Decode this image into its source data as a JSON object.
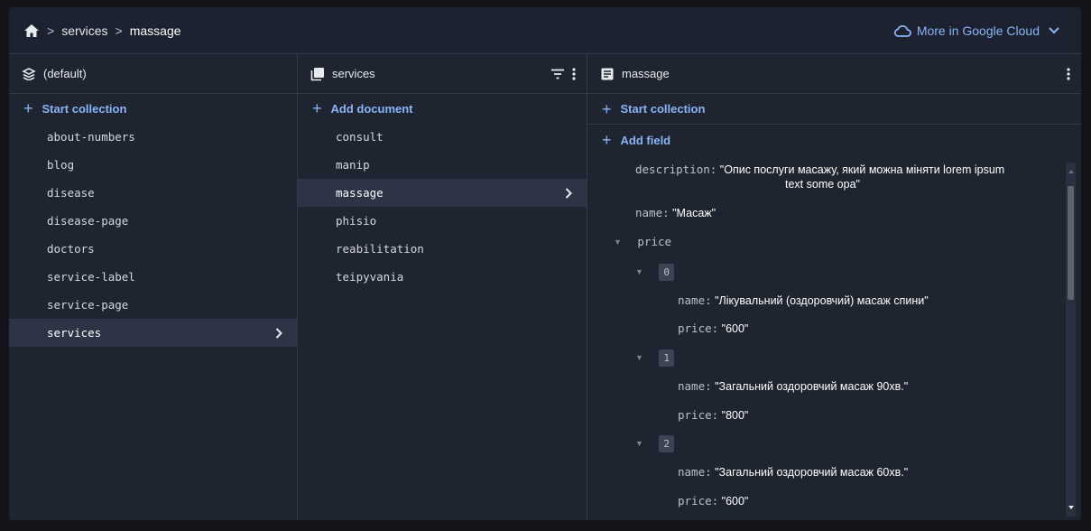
{
  "breadcrumb": {
    "items": [
      "services",
      "massage"
    ]
  },
  "header": {
    "cloud_label": "More in Google Cloud"
  },
  "col1": {
    "title": "(default)",
    "add_label": "Start collection",
    "items": [
      "about-numbers",
      "blog",
      "disease",
      "disease-page",
      "doctors",
      "service-label",
      "service-page",
      "services"
    ],
    "selected_index": 7
  },
  "col2": {
    "title": "services",
    "add_label": "Add document",
    "items": [
      "consult",
      "manip",
      "massage",
      "phisio",
      "reabilitation",
      "teipyvania"
    ],
    "selected_index": 2
  },
  "col3": {
    "title": "massage",
    "start_collection_label": "Start collection",
    "add_field_label": "Add field",
    "fields": {
      "description_key": "description:",
      "description_val_1": "\"Опис послуги масажу, який можна міняти lorem ipsum",
      "description_val_2": "text some opa\"",
      "name_key": "name:",
      "name_val": "\"Масаж\"",
      "price_key": "price",
      "price_items": [
        {
          "index": "0",
          "name_key": "name:",
          "name_val": "\"Лікувальний (оздоровчий) масаж спини\"",
          "price_key": "price:",
          "price_val": "\"600\""
        },
        {
          "index": "1",
          "name_key": "name:",
          "name_val": "\"Загальний оздоровчий масаж 90хв.\"",
          "price_key": "price:",
          "price_val": "\"800\""
        },
        {
          "index": "2",
          "name_key": "name:",
          "name_val": "\"Загальний оздоровчий масаж 60хв.\"",
          "price_key": "price:",
          "price_val": "\"600\""
        }
      ]
    }
  },
  "colors": {
    "accent": "#8ab4f8",
    "background": "#1e2430",
    "selected": "#2c3446"
  }
}
